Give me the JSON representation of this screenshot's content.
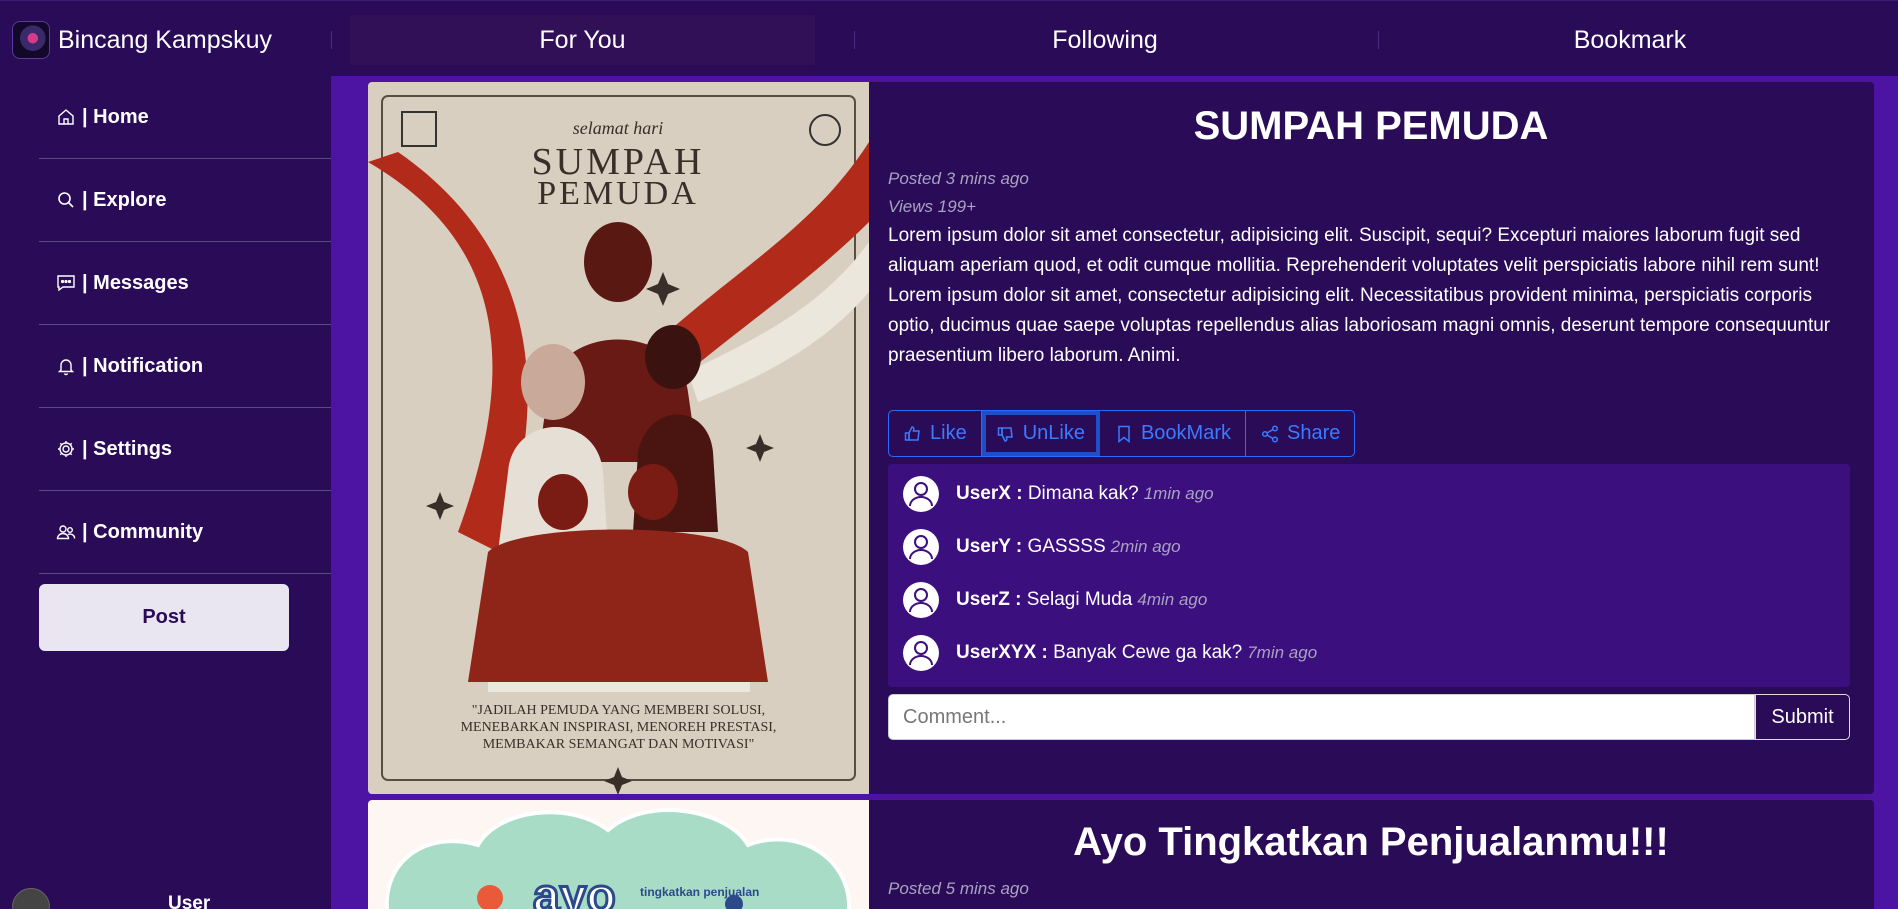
{
  "app": {
    "title": "Bincang Kampskuy"
  },
  "tabs": [
    {
      "label": "For You",
      "active": true
    },
    {
      "label": "Following",
      "active": false
    },
    {
      "label": "Bookmark",
      "active": false
    }
  ],
  "sidebar": {
    "items": [
      {
        "label": "| Home",
        "icon": "home-icon"
      },
      {
        "label": "| Explore",
        "icon": "search-icon"
      },
      {
        "label": "| Messages",
        "icon": "message-icon"
      },
      {
        "label": "| Notification",
        "icon": "bell-icon"
      },
      {
        "label": "| Settings",
        "icon": "gear-icon"
      },
      {
        "label": "| Community",
        "icon": "people-icon"
      }
    ],
    "post_label": "Post",
    "user_label": "User"
  },
  "posts": [
    {
      "title": "SUMPAH PEMUDA",
      "posted": "Posted 3 mins ago",
      "views": "Views 199+",
      "body": "Lorem ipsum dolor sit amet consectetur, adipisicing elit. Suscipit, sequi? Excepturi maiores laborum fugit sed aliquam aperiam quod, et odit cumque mollitia. Reprehenderit voluptates velit perspiciatis labore nihil rem sunt! Lorem ipsum dolor sit amet, consectetur adipisicing elit. Necessitatibus provident minima, perspiciatis corporis optio, ducimus quae saepe voluptas repellendus alias laboriosam magni omnis, deserunt tempore consequuntur praesentium libero laborum. Animi.",
      "actions": {
        "like": "Like",
        "unlike": "UnLike",
        "bookmark": "BookMark",
        "share": "Share"
      },
      "comments": [
        {
          "user": "UserX :",
          "text": "Dimana kak?",
          "time": "1min ago"
        },
        {
          "user": "UserY :",
          "text": "GASSSS",
          "time": "2min ago"
        },
        {
          "user": "UserZ :",
          "text": "Selagi Muda",
          "time": "4min ago"
        },
        {
          "user": "UserXYX :",
          "text": "Banyak Cewe ga kak?",
          "time": "7min ago"
        }
      ],
      "comment_placeholder": "Comment...",
      "submit_label": "Submit",
      "poster": {
        "script": "selamat hari",
        "headline_1": "SUMPAH",
        "headline_2": "PEMUDA",
        "quote": "\"JADILAH PEMUDA YANG MEMBERI SOLUSI, MENEBARKAN INSPIRASI, MENOREH PRESTASI, MEMBAKAR SEMANGAT DAN MOTIVASI\""
      }
    },
    {
      "title": "Ayo Tingkatkan Penjualanmu!!!",
      "posted": "Posted 5 mins ago",
      "poster": {
        "word": "ayo",
        "small": "tingkatkan penjualan"
      }
    }
  ],
  "colors": {
    "bg": "#2a0b57",
    "accent": "#4d14a3",
    "button_blue": "#3a7bff"
  }
}
